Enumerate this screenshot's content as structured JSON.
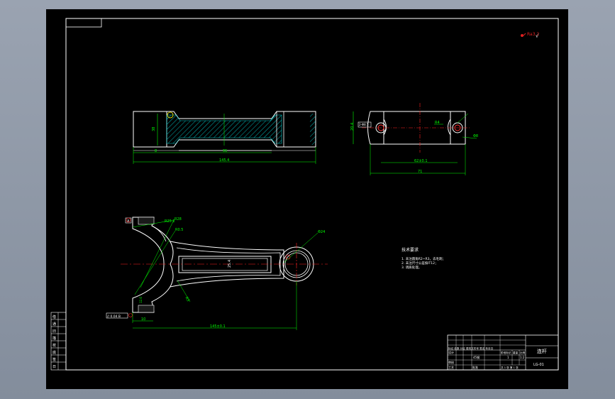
{
  "surface_roughness": "√",
  "views": {
    "front": {
      "dim_height": "38",
      "dim_left": "8",
      "dim_mid": "95",
      "dim_total": "145.4"
    },
    "side": {
      "dim_thk": "20.4",
      "bore_label": "2-Φ8.5",
      "bore_callout": "Φ8",
      "chamfer": "R4",
      "dim_center": "62±0.1",
      "dim_total": "71"
    },
    "plan": {
      "datum_a": "A",
      "datum_b": "B",
      "leader_r1": "R28",
      "leader_r2": "R25.2",
      "leader_r3": "R0.5",
      "small_bore": "Φ24",
      "web_dim": "25.4",
      "rib_dim": "12.6",
      "fillet": "R3",
      "geo_tol": "// 0.04 B",
      "dim_offset": "10",
      "dim_center": "145±0.1"
    }
  },
  "notes": {
    "title": "技术要求",
    "items": [
      "1. 未注圆角R2~R3，去毛刺；",
      "2. 未注尺寸公差按IT12；",
      "3. 调质处理。"
    ]
  },
  "title_block": {
    "part_name": "连杆",
    "material": "45钢",
    "scale": "1:2",
    "quantity": "1",
    "sheet": "共 1 张 第 1 张",
    "revision_row": "标记 处数 分区 更改文件号 签名 年月日",
    "design": "设计",
    "check": "审核",
    "process": "工艺",
    "approve": "批准",
    "stage": "阶段标记",
    "weight": "重量",
    "ratio": "比例",
    "drawing_no": "LG-01"
  },
  "left_stamp": {
    "rows": [
      "借",
      "通",
      "旧",
      "描",
      "校",
      "底",
      "签",
      "日"
    ]
  },
  "colors": {
    "background": "#000000",
    "outline": "#ffffff",
    "dimension": "#00ff00",
    "centerline": "#ff0000",
    "hatch": "#00c8c8",
    "note": "#ffffff"
  }
}
